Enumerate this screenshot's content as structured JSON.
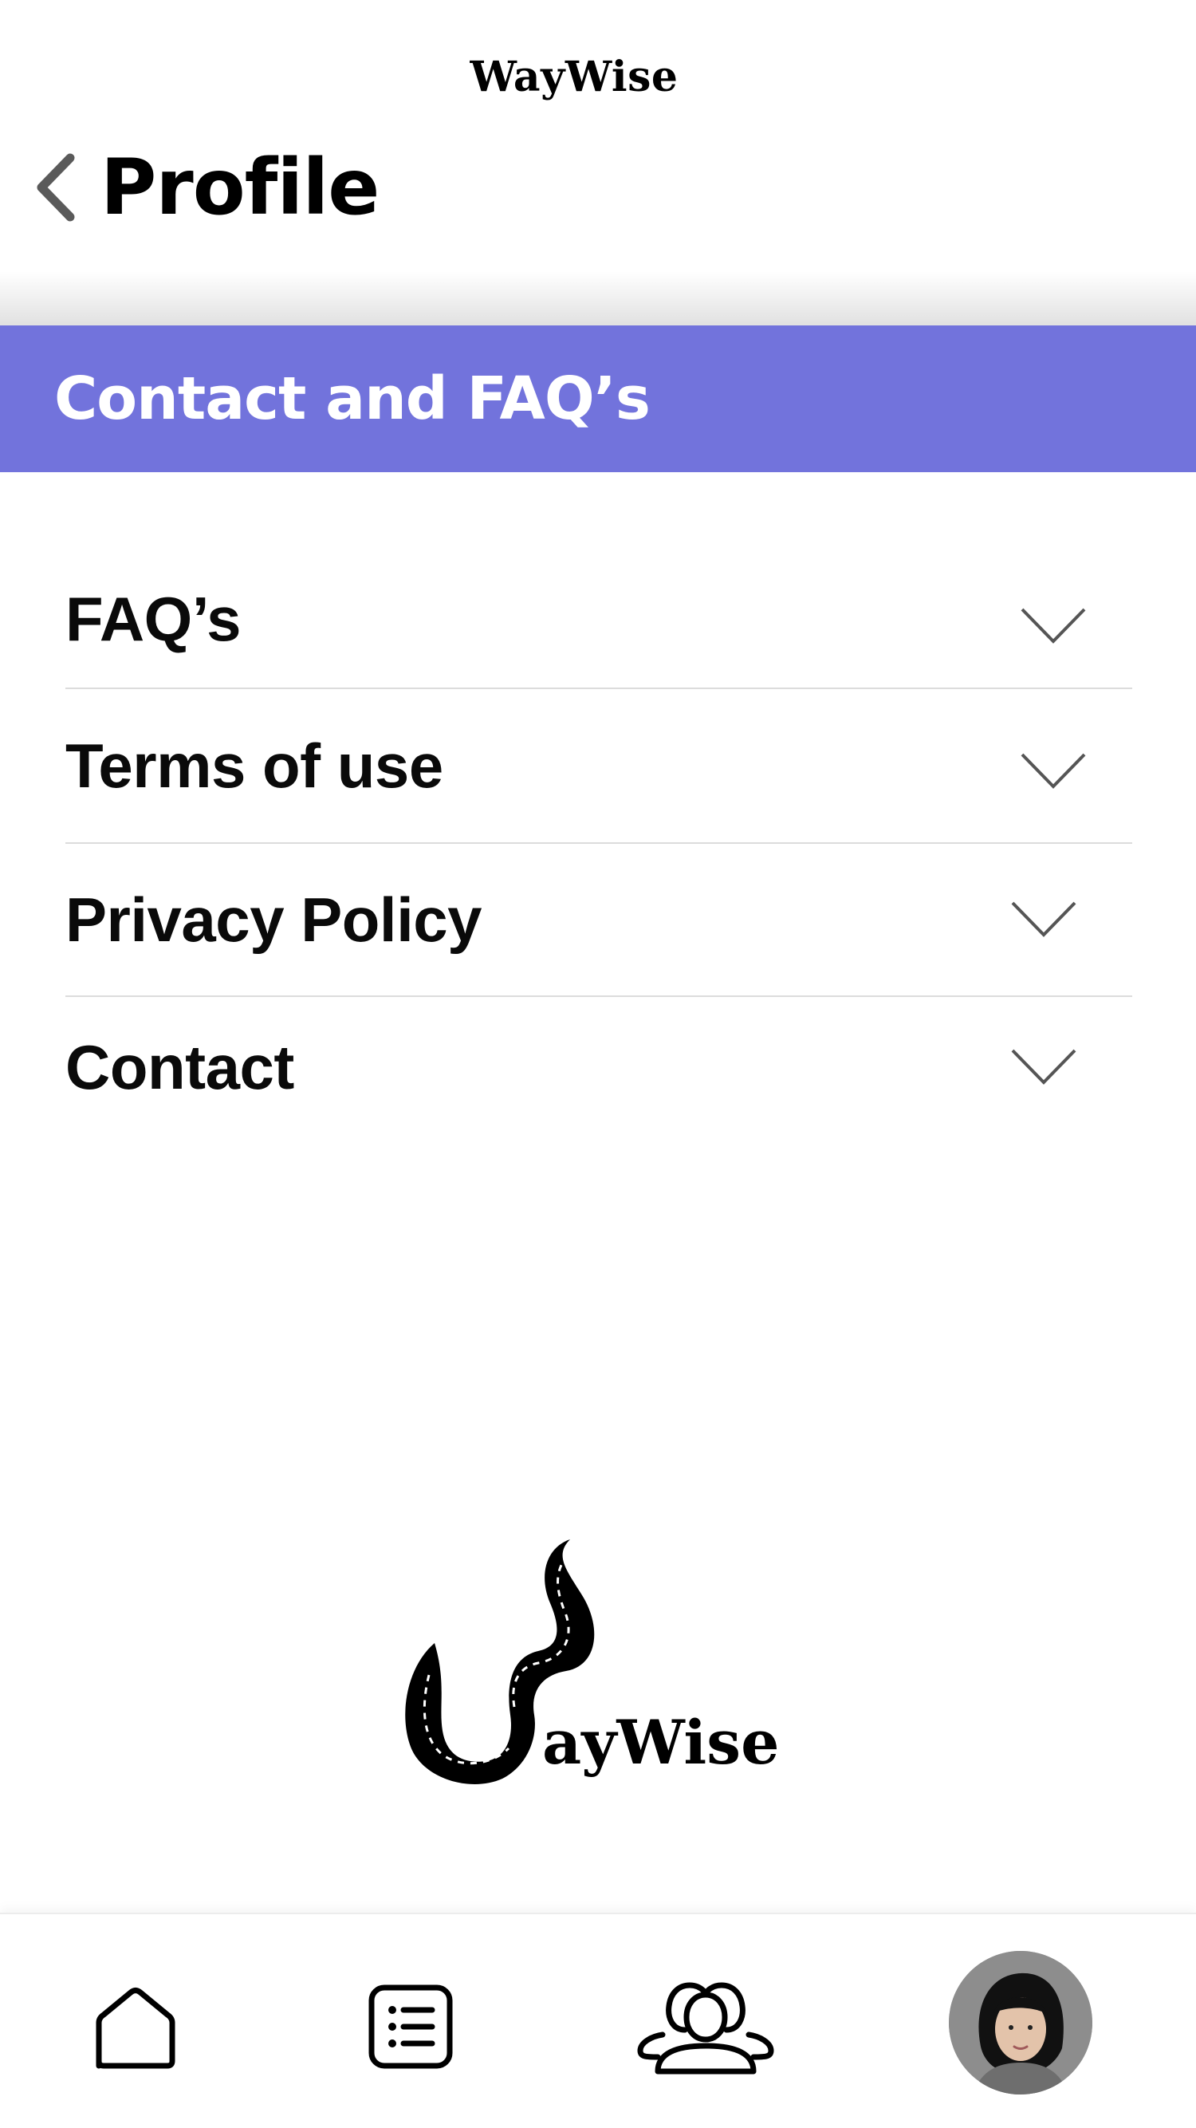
{
  "app": {
    "brand": "WayWise"
  },
  "header": {
    "title": "Profile"
  },
  "section": {
    "title": "Contact and FAQ’s"
  },
  "accordion": {
    "items": [
      {
        "label": "FAQ’s",
        "expanded": false
      },
      {
        "label": "Terms of use",
        "expanded": false
      },
      {
        "label": "Privacy Policy",
        "expanded": false
      },
      {
        "label": "Contact",
        "expanded": false
      }
    ]
  },
  "logo": {
    "text": "ayWise"
  },
  "nav": {
    "items": [
      {
        "name": "home",
        "icon": "home-icon"
      },
      {
        "name": "list",
        "icon": "list-icon"
      },
      {
        "name": "community",
        "icon": "group-icon"
      },
      {
        "name": "profile",
        "icon": "avatar"
      }
    ]
  },
  "colors": {
    "banner": "#7273dc",
    "banner_text": "#ffffff",
    "divider": "#dcdcdc",
    "chevron": "#555555"
  }
}
